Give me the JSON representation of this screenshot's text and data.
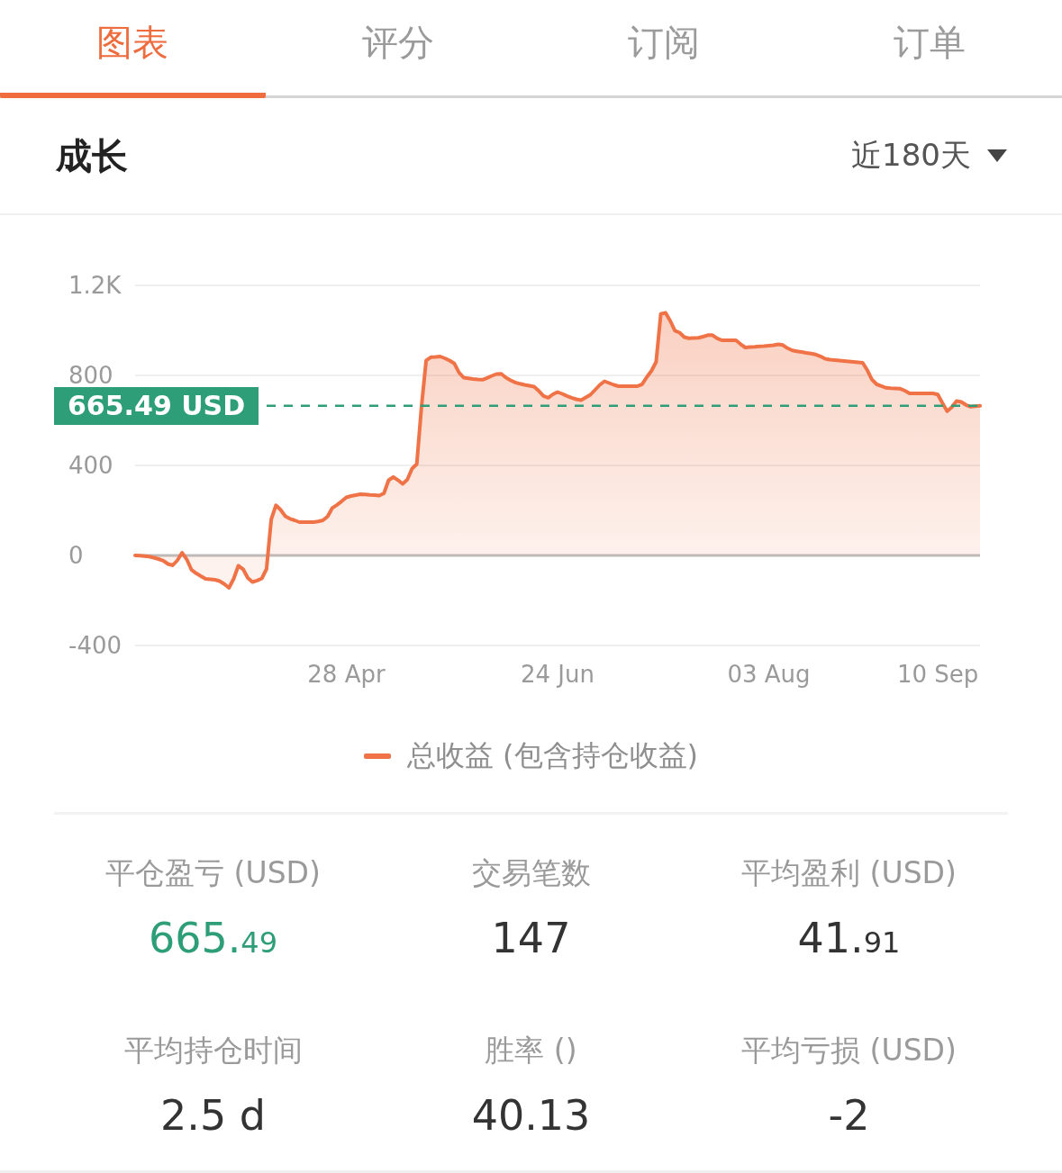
{
  "tabs": [
    {
      "label": "图表",
      "selected": true
    },
    {
      "label": "评分",
      "selected": false
    },
    {
      "label": "订阅",
      "selected": false
    },
    {
      "label": "订单",
      "selected": false
    }
  ],
  "section": {
    "title": "成长",
    "period": "近180天"
  },
  "chart": {
    "chart_data": {
      "type": "area",
      "categories": [
        null,
        null,
        null,
        null,
        null,
        null,
        null,
        null,
        null,
        null,
        null,
        null,
        null,
        null,
        null,
        null,
        null,
        null,
        null,
        null,
        null,
        null,
        null,
        null,
        null,
        null,
        null,
        null,
        null,
        null,
        null,
        null,
        null,
        null,
        null,
        null,
        null,
        null,
        null,
        null,
        null,
        null,
        null,
        null,
        null,
        "28 Apr",
        null,
        null,
        null,
        null,
        null,
        null,
        null,
        null,
        null,
        null,
        null,
        null,
        null,
        null,
        null,
        null,
        null,
        null,
        null,
        null,
        null,
        null,
        null,
        null,
        null,
        null,
        null,
        null,
        null,
        null,
        null,
        null,
        null,
        null,
        null,
        null,
        null,
        null,
        null,
        null,
        null,
        null,
        null,
        null,
        "24 Jun",
        null,
        null,
        null,
        null,
        null,
        null,
        null,
        null,
        null,
        null,
        null,
        null,
        null,
        null,
        null,
        null,
        null,
        null,
        null,
        null,
        null,
        null,
        null,
        null,
        null,
        null,
        null,
        null,
        null,
        null,
        null,
        null,
        null,
        null,
        null,
        null,
        null,
        null,
        null,
        null,
        null,
        null,
        null,
        null,
        "03 Aug",
        null,
        null,
        null,
        null,
        null,
        null,
        null,
        null,
        null,
        null,
        null,
        null,
        null,
        null,
        null,
        null,
        null,
        null,
        null,
        null,
        null,
        null,
        null,
        null,
        null,
        null,
        null,
        null,
        null,
        null,
        null,
        null,
        null,
        null,
        null,
        "10 Sep",
        null,
        null,
        null,
        null,
        null,
        null,
        null,
        null,
        null
      ],
      "series": [
        {
          "name": "总收益 (包含持仓收益)",
          "color": "#ef7346",
          "values": [
            0,
            -1,
            -3,
            -5,
            -10,
            -16,
            -23,
            -38,
            -44,
            -22,
            12,
            -17,
            -63,
            -79,
            -92,
            -104,
            -106,
            -108,
            -114,
            -127,
            -144,
            -104,
            -46,
            -61,
            -100,
            -118,
            -111,
            -102,
            -60,
            160,
            223,
            203,
            174,
            163,
            156,
            148,
            148,
            148,
            148,
            151,
            156,
            173,
            211,
            225,
            241,
            258,
            264,
            268,
            272,
            271,
            269,
            268,
            266,
            276,
            334,
            349,
            335,
            318,
            337,
            386,
            406,
            660,
            867,
            881,
            882,
            884,
            876,
            866,
            853,
            813,
            790,
            787,
            784,
            782,
            781,
            789,
            798,
            806,
            807,
            790,
            778,
            769,
            763,
            758,
            754,
            750,
            731,
            709,
            701,
            716,
            726,
            718,
            709,
            701,
            694,
            690,
            702,
            714,
            736,
            758,
            774,
            766,
            758,
            752,
            752,
            752,
            752,
            752,
            761,
            792,
            820,
            860,
            1073,
            1078,
            1042,
            999,
            990,
            970,
            965,
            966,
            967,
            972,
            979,
            979,
            965,
            956,
            956,
            956,
            956,
            939,
            924,
            926,
            927,
            929,
            930,
            932,
            934,
            938,
            935,
            921,
            911,
            907,
            904,
            900,
            897,
            893,
            885,
            874,
            870,
            868,
            866,
            864,
            862,
            860,
            858,
            856,
            823,
            781,
            760,
            753,
            745,
            743,
            742,
            741,
            732,
            720,
            720,
            720,
            720,
            720,
            720,
            715,
            677,
            641,
            659,
            686,
            682,
            669,
            661,
            663,
            665
          ]
        }
      ],
      "ylim": [
        -400,
        1200
      ],
      "yticks": [
        -400,
        0,
        400,
        800,
        {
          "value": 1200,
          "label": "1.2K"
        }
      ],
      "ref_lines": [
        {
          "axis": "y",
          "value": 665.49,
          "label": "665.49 USD"
        }
      ]
    }
  },
  "stats": [
    {
      "label": "平仓盈亏 (USD)",
      "value": "665.",
      "fraction": "49",
      "color": "#2e9e78"
    },
    {
      "label": "交易笔数",
      "value": "147",
      "color": "#333333"
    },
    {
      "label": "平均盈利 (USD)",
      "value": "41.",
      "fraction": "91",
      "color": "#333333"
    },
    {
      "label": "平均持仓时间",
      "value": "2.5 d",
      "color": "#333333"
    },
    {
      "label": "胜率 ()",
      "value": "40.13",
      "color": "#333333"
    },
    {
      "label": "平均亏损 (USD)",
      "value": "-2",
      "color": "#333333"
    }
  ]
}
